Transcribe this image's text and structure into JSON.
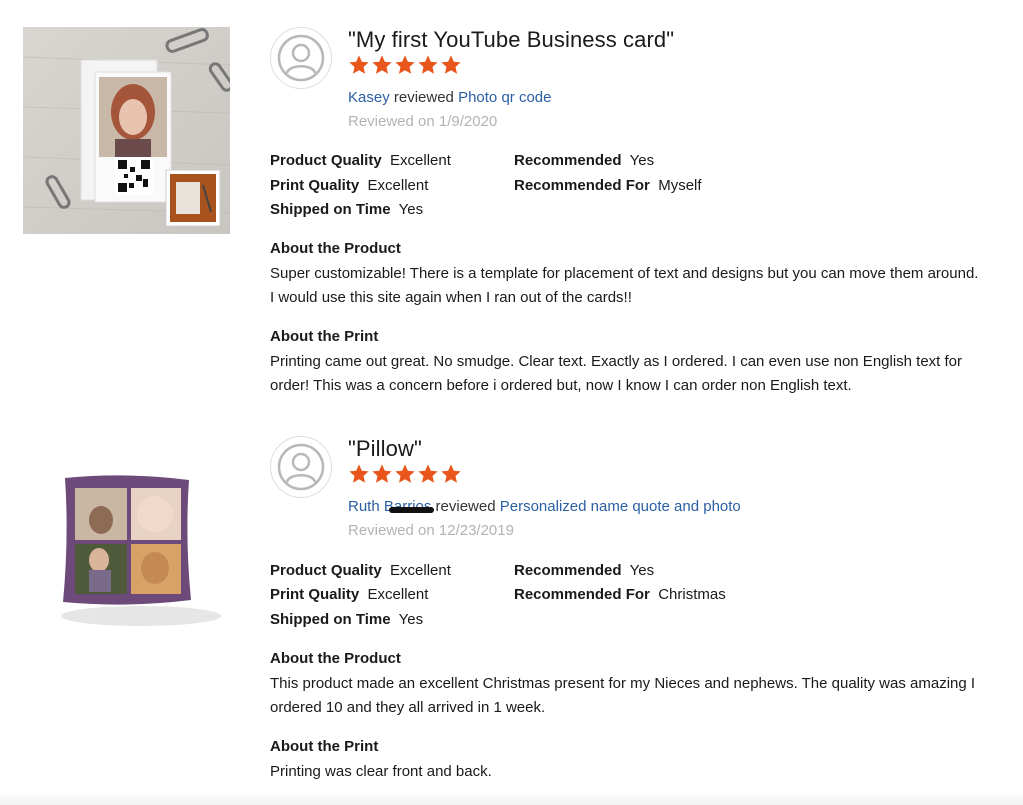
{
  "reviews": [
    {
      "title": "\"My first YouTube Business card\"",
      "rating": 5,
      "reviewer": "Kasey",
      "reviewed_word": "reviewed",
      "product": "Photo qr code",
      "date": "Reviewed on 1/9/2020",
      "attrs": {
        "quality_label": "Product Quality",
        "quality_value": "Excellent",
        "print_label": "Print Quality",
        "print_value": "Excellent",
        "shipped_label": "Shipped on Time",
        "shipped_value": "Yes",
        "recommended_label": "Recommended",
        "recommended_value": "Yes",
        "for_label": "Recommended For",
        "for_value": "Myself"
      },
      "about_product_heading": "About the Product",
      "about_product_text": "Super customizable! There is a template for placement of text and designs but you can move them around. I would use this site again when I ran out of the cards!!",
      "about_print_heading": "About the Print",
      "about_print_text": "Printing came out great. No smudge. Clear text. Exactly as I ordered. I can even use non English text for order! This was a concern before i ordered but, now I know I can order non English text."
    },
    {
      "title": "\"Pillow\"",
      "rating": 5,
      "reviewer": "Ruth Barrios",
      "reviewed_word": "reviewed",
      "product": "Personalized name quote and photo",
      "date": "Reviewed on 12/23/2019",
      "attrs": {
        "quality_label": "Product Quality",
        "quality_value": "Excellent",
        "print_label": "Print Quality",
        "print_value": "Excellent",
        "shipped_label": "Shipped on Time",
        "shipped_value": "Yes",
        "recommended_label": "Recommended",
        "recommended_value": "Yes",
        "for_label": "Recommended For",
        "for_value": "Christmas"
      },
      "about_product_heading": "About the Product",
      "about_product_text": "This product made an excellent Christmas present for my Nieces and nephews. The quality was amazing I ordered 10 and they all arrived in 1 week.",
      "about_print_heading": "About the Print",
      "about_print_text": "Printing was clear front and back."
    }
  ],
  "colors": {
    "star": "#e8561c",
    "link": "#2b5fa3",
    "muted": "#b3b3b3"
  },
  "icons": {
    "avatar": "user-avatar-icon",
    "star": "star-icon"
  }
}
